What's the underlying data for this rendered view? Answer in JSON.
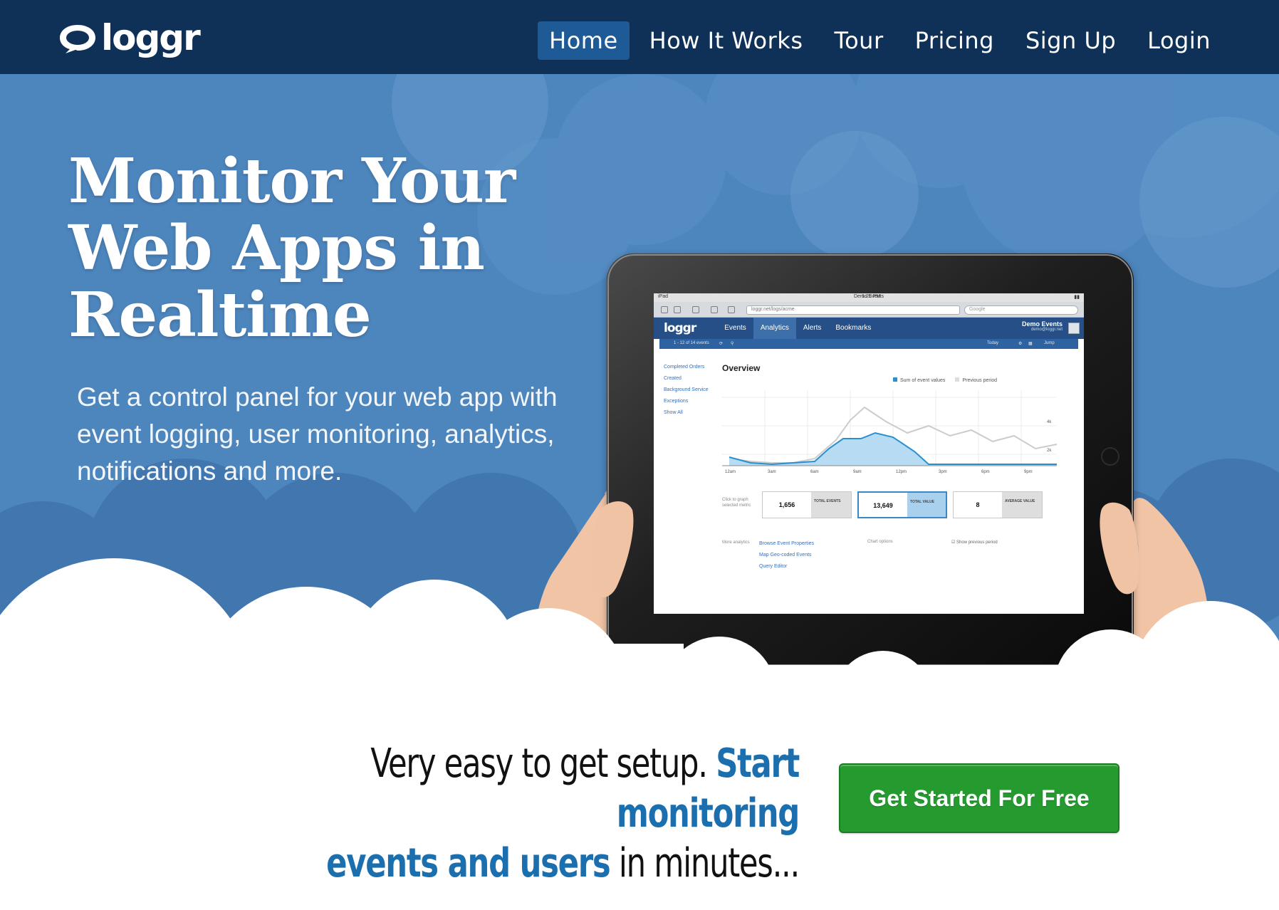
{
  "nav": {
    "logo_text": "loggr",
    "items": [
      {
        "label": "Home",
        "active": true
      },
      {
        "label": "How It Works"
      },
      {
        "label": "Tour"
      },
      {
        "label": "Pricing"
      },
      {
        "label": "Sign Up"
      },
      {
        "label": "Login"
      }
    ]
  },
  "hero": {
    "headline_lines": [
      "Monitor Your",
      "Web Apps in",
      "Realtime"
    ],
    "subtext": "Get a control panel for your web app with event logging, user monitoring, analytics, notifications and more."
  },
  "tablet": {
    "status_left": "iPad",
    "status_time": "1:25 PM",
    "browser_title": "Demo Events",
    "url": "loggr.net/logs/acme",
    "search_placeholder": "Google",
    "app_logo": "loggr",
    "tabs": [
      "Events",
      "Analytics",
      "Alerts",
      "Bookmarks"
    ],
    "active_tab": "Analytics",
    "account_name": "Demo Events",
    "account_sub": "demo@loggr.net",
    "sub_bar_left": "1 - 12 of 14 events",
    "sub_bar_right_1": "Today",
    "sub_bar_right_2": "Jump",
    "side_links": [
      "Completed Orders",
      "Created",
      "Background Service",
      "Exceptions",
      "Show All"
    ],
    "overview_title": "Overview",
    "legend_current": "Sum of event values",
    "legend_previous": "Previous period",
    "x_ticks": [
      "12am",
      "3am",
      "6am",
      "9am",
      "12pm",
      "3pm",
      "6pm",
      "9pm"
    ],
    "y_ticks": [
      "4k",
      "2k"
    ],
    "stats_caption": "Click to graph selected metric",
    "stats": [
      {
        "value": "1,656",
        "label": "TOTAL EVENTS"
      },
      {
        "value": "13,649",
        "label": "TOTAL VALUE",
        "selected": true
      },
      {
        "value": "8",
        "label": "AVERAGE VALUE"
      }
    ],
    "more_caption": "More analytics",
    "more_links": [
      "Browse Event Properties",
      "Map Geo-coded Events",
      "Query Editor"
    ],
    "chart_options_label": "Chart options",
    "show_previous_label": "Show previous period"
  },
  "cta": {
    "line1_plain": "Very easy to get setup.",
    "line1_highlight": "Start monitoring",
    "line2_highlight": "events and users",
    "line2_plain": "in minutes...",
    "button_label": "Get Started For Free"
  },
  "colors": {
    "nav_bg": "#0f3158",
    "nav_active": "#1e5a95",
    "hero_bg": "#4d85bd",
    "highlight": "#1b6fae",
    "button": "#249a2f"
  }
}
